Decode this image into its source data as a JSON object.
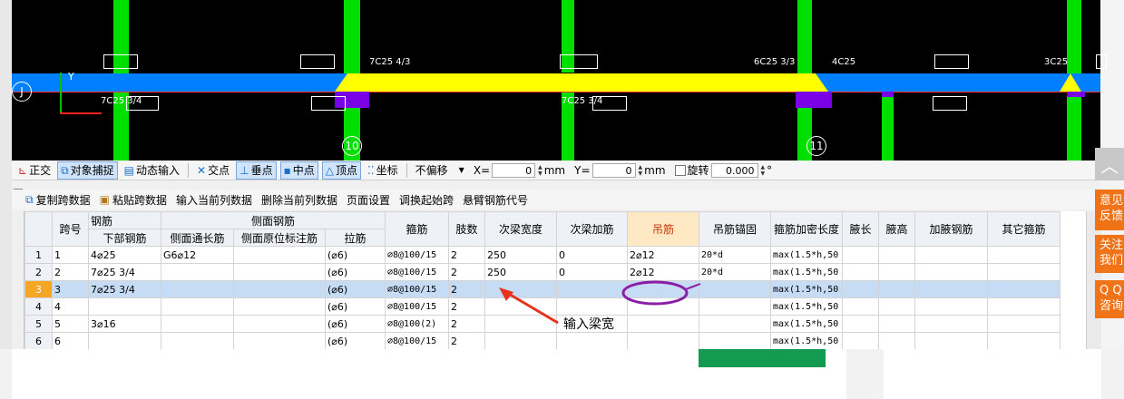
{
  "cad": {
    "labels": [
      "7C25 4/3",
      "6C25 3/3",
      "4C25",
      "3C25",
      "7C25 3/4",
      "7C25 3/4"
    ],
    "axis_y": "Y",
    "bubbles": [
      "J",
      "10",
      "11"
    ]
  },
  "toolbar1": {
    "orthogonal": "正交",
    "object_snap": "对象捕捉",
    "dynamic_input": "动态输入",
    "intersection": "交点",
    "perpendicular": "垂点",
    "midpoint": "中点",
    "vertex": "顶点",
    "coordinate": "坐标",
    "offset_select": "不偏移",
    "x_label": "X=",
    "x_value": "0",
    "unit_mm": "mm",
    "y_label": "Y=",
    "y_value": "0",
    "rotate_label": "旋转",
    "rotate_value": "0.000",
    "degree": "°"
  },
  "toolbar2": {
    "items": [
      "复制跨数据",
      "粘贴跨数据",
      "输入当前列数据",
      "删除当前列数据",
      "页面设置",
      "调换起始跨",
      "悬臂钢筋代号"
    ]
  },
  "grid": {
    "headers_top": {
      "span": "跨号",
      "rebar": "钢筋",
      "side_rebar": "侧面钢筋",
      "stirrup": "箍筋",
      "legs": "肢数",
      "sec_beam_width": "次梁宽度",
      "sec_beam_rebar": "次梁加筋",
      "hanger": "吊筋",
      "hanger_anchor": "吊筋锚固",
      "stirrup_dense_len": "箍筋加密长度",
      "haunch_len": "腋长",
      "haunch_height": "腋高",
      "haunch_rebar": "加腋钢筋",
      "other_stirrup": "其它箍筋"
    },
    "headers_sub": {
      "bottom_rebar": "下部钢筋",
      "side_long_rebar": "侧面通长筋",
      "side_orig_rebar": "侧面原位标注筋",
      "tie": "拉筋"
    },
    "rows": [
      {
        "rn": "1",
        "span": "1",
        "bottom": "4⌀25",
        "side_long": "G6⌀12",
        "side_orig": "",
        "tie": "(⌀6)",
        "stirrup": "⌀8@100/15",
        "legs": "2",
        "sec_w": "250",
        "sec_r": "0",
        "hanger": "2⌀12",
        "anchor": "20*d",
        "dense": "max(1.5*h,50",
        "hl": "",
        "hh": "",
        "hr": "",
        "other": ""
      },
      {
        "rn": "2",
        "span": "2",
        "bottom": "7⌀25 3/4",
        "side_long": "",
        "side_orig": "",
        "tie": "(⌀6)",
        "stirrup": "⌀8@100/15",
        "legs": "2",
        "sec_w": "250",
        "sec_r": "0",
        "hanger": "2⌀12",
        "anchor": "20*d",
        "dense": "max(1.5*h,50",
        "hl": "",
        "hh": "",
        "hr": "",
        "other": ""
      },
      {
        "rn": "3",
        "span": "3",
        "bottom": "7⌀25 3/4",
        "side_long": "",
        "side_orig": "",
        "tie": "(⌀6)",
        "stirrup": "⌀8@100/15",
        "legs": "2",
        "sec_w": "",
        "sec_r": "",
        "hanger": "",
        "anchor": "",
        "dense": "max(1.5*h,50",
        "hl": "",
        "hh": "",
        "hr": "",
        "other": ""
      },
      {
        "rn": "4",
        "span": "4",
        "bottom": "",
        "side_long": "",
        "side_orig": "",
        "tie": "(⌀6)",
        "stirrup": "⌀8@100/15",
        "legs": "2",
        "sec_w": "",
        "sec_r": "",
        "hanger": "",
        "anchor": "",
        "dense": "max(1.5*h,50",
        "hl": "",
        "hh": "",
        "hr": "",
        "other": ""
      },
      {
        "rn": "5",
        "span": "5",
        "bottom": "3⌀16",
        "side_long": "",
        "side_orig": "",
        "tie": "(⌀6)",
        "stirrup": "⌀8@100(2)",
        "legs": "2",
        "sec_w": "",
        "sec_r": "",
        "hanger": "",
        "anchor": "",
        "dense": "max(1.5*h,50",
        "hl": "",
        "hh": "",
        "hr": "",
        "other": ""
      },
      {
        "rn": "6",
        "span": "6",
        "bottom": "",
        "side_long": "",
        "side_orig": "",
        "tie": "(⌀6)",
        "stirrup": "⌀8@100/15",
        "legs": "2",
        "sec_w": "",
        "sec_r": "",
        "hanger": "",
        "anchor": "",
        "dense": "max(1.5*h,50",
        "hl": "",
        "hh": "",
        "hr": "",
        "other": ""
      }
    ]
  },
  "annotation": {
    "text": "输入梁宽"
  },
  "side_buttons": {
    "feedback": [
      "意见",
      "反馈"
    ],
    "follow": [
      "关注",
      "我们"
    ],
    "qq": [
      "Q Q",
      "咨询"
    ]
  },
  "colors": {
    "beam_blue": "#0080ff",
    "beam_yellow": "#ffff00",
    "column_green": "#00e000",
    "support_purple": "#7a00e6",
    "hanger_header": "#c7380a",
    "selected_row": "#c6dcf5",
    "side_orange": "#f07318",
    "annotation_circle": "#8a1ea6",
    "annotation_arrow": "#e8321e"
  }
}
